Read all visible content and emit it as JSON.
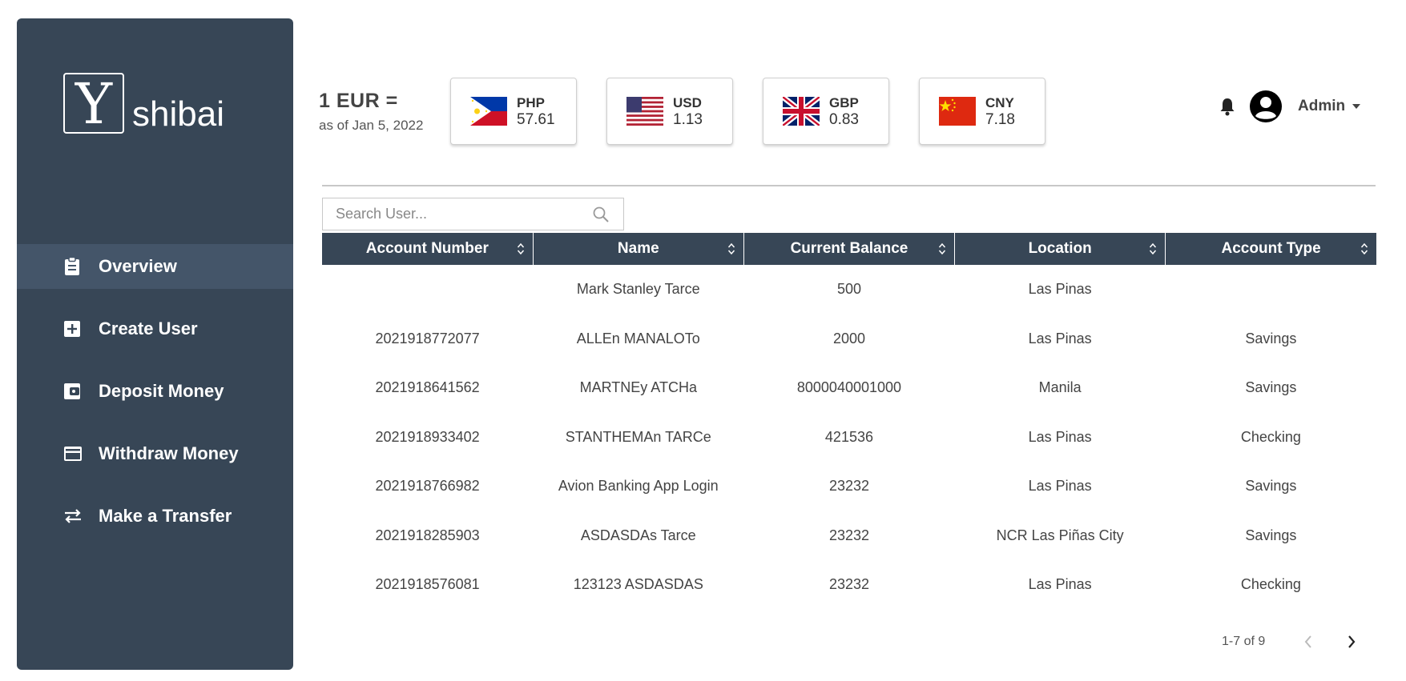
{
  "brand": {
    "logo_letter": "Y",
    "name": "shibai"
  },
  "nav": [
    {
      "label": "Overview",
      "icon": "clipboard-icon",
      "active": true
    },
    {
      "label": "Create User",
      "icon": "plus-box-icon"
    },
    {
      "label": "Deposit Money",
      "icon": "wallet-icon"
    },
    {
      "label": "Withdraw Money",
      "icon": "credit-card-icon"
    },
    {
      "label": "Make a Transfer",
      "icon": "swap-arrows-icon"
    }
  ],
  "rates": {
    "base": "1 EUR =",
    "as_of": "as of Jan 5, 2022",
    "items": [
      {
        "code": "PHP",
        "value": "57.61"
      },
      {
        "code": "USD",
        "value": "1.13"
      },
      {
        "code": "GBP",
        "value": "0.83"
      },
      {
        "code": "CNY",
        "value": "7.18"
      }
    ]
  },
  "user": {
    "name": "Admin"
  },
  "search": {
    "placeholder": "Search User..."
  },
  "table": {
    "columns": [
      "Account Number",
      "Name",
      "Current Balance",
      "Location",
      "Account Type"
    ],
    "rows": [
      [
        "",
        "Mark Stanley Tarce",
        "500",
        "Las Pinas",
        ""
      ],
      [
        "2021918772077",
        "ALLEn MANALOTo",
        "2000",
        "Las Pinas",
        "Savings"
      ],
      [
        "2021918641562",
        "MARTNEy ATCHa",
        "8000040001000",
        "Manila",
        "Savings"
      ],
      [
        "2021918933402",
        "STANTHEMAn TARCe",
        "421536",
        "Las Pinas",
        "Checking"
      ],
      [
        "2021918766982",
        "Avion Banking App Login",
        "23232",
        "Las Pinas",
        "Savings"
      ],
      [
        "2021918285903",
        "ASDASDAs Tarce",
        "23232",
        "NCR Las Piñas City",
        "Savings"
      ],
      [
        "2021918576081",
        "123123 ASDASDAS",
        "23232",
        "Las Pinas",
        "Checking"
      ]
    ]
  },
  "pagination": {
    "text": "1-7 of 9"
  },
  "colors": {
    "sidebar": "#374656",
    "sidebar_active": "#445569",
    "header": "#374656"
  }
}
